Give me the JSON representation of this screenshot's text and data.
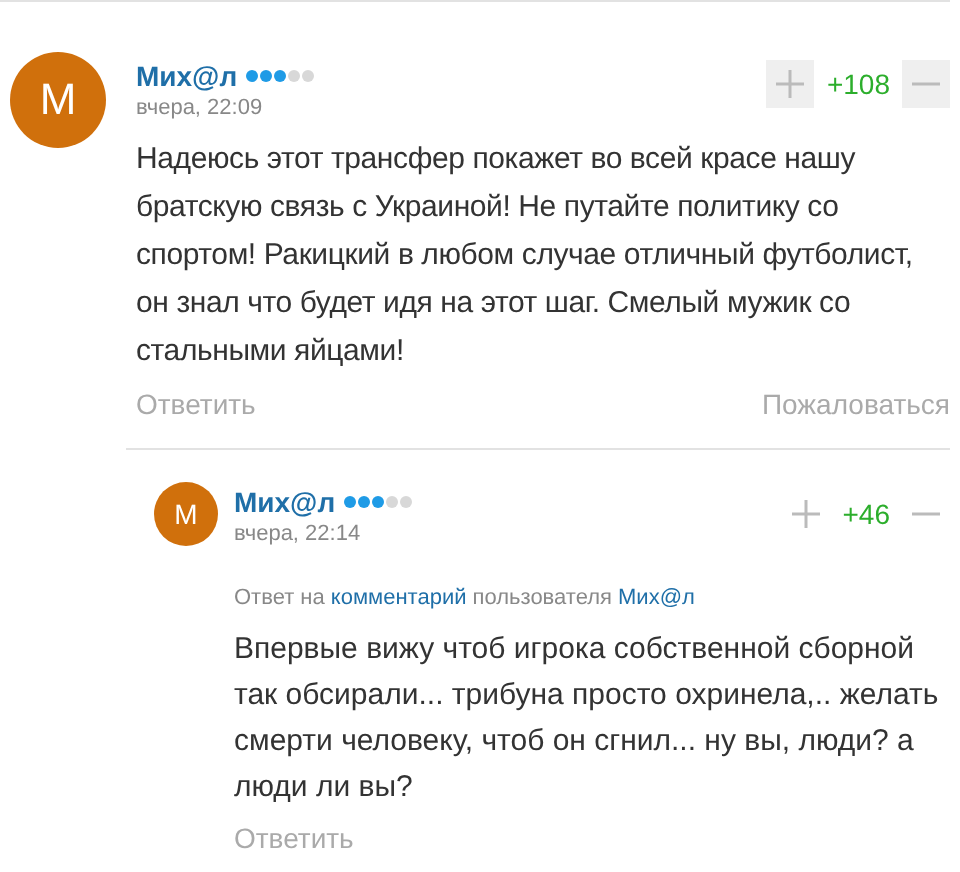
{
  "comments": [
    {
      "avatar": "M",
      "author": "Мих@л",
      "stars": 3,
      "time": "вчера, 22:09",
      "votes": "+108",
      "vote_hovered": true,
      "text": "Надеюсь этот трансфер покажет во всей красе нашу братскую связь с Украиной! Не путайте политику со спортом! Ракицкий в любом случае отличный футболист, он знал что будет идя на этот шаг. Смелый мужик со стальными яйцами!",
      "reply": "Ответить",
      "complain": "Пожаловаться",
      "replies": [
        {
          "avatar": "M",
          "author": "Мих@л",
          "stars": 3,
          "time": "вчера, 22:14",
          "votes": "+46",
          "vote_hovered": false,
          "reply_to": {
            "prefix": "Ответ на",
            "link": "комментарий",
            "middle": "пользователя",
            "user": "Мих@л"
          },
          "text": "Впервые вижу чтоб игрока собственной сборной так обсирали... трибуна просто охринела,.. желать смерти человеку, чтоб он сгнил... ну вы, люди? а люди ли вы?",
          "reply": "Ответить"
        }
      ]
    }
  ]
}
